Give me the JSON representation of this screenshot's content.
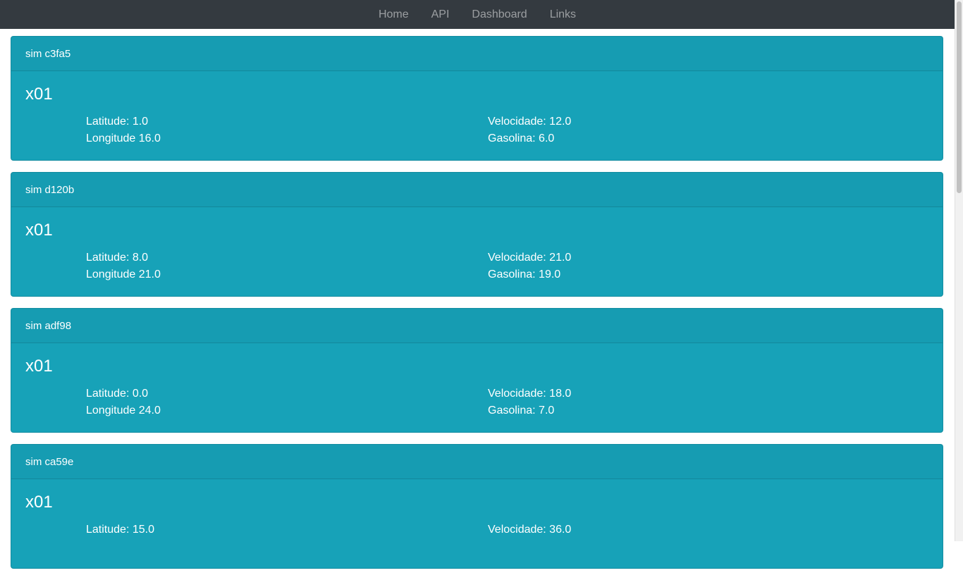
{
  "nav": {
    "items": [
      "Home",
      "API",
      "Dashboard",
      "Links"
    ]
  },
  "cards": [
    {
      "header": "sim c3fa5",
      "title": "x01",
      "latitude": "Latitude: 1.0",
      "longitude": "Longitude 16.0",
      "velocidade": "Velocidade: 12.0",
      "gasolina": "Gasolina: 6.0"
    },
    {
      "header": "sim d120b",
      "title": "x01",
      "latitude": "Latitude: 8.0",
      "longitude": "Longitude 21.0",
      "velocidade": "Velocidade: 21.0",
      "gasolina": "Gasolina: 19.0"
    },
    {
      "header": "sim adf98",
      "title": "x01",
      "latitude": "Latitude: 0.0",
      "longitude": "Longitude 24.0",
      "velocidade": "Velocidade: 18.0",
      "gasolina": "Gasolina: 7.0"
    },
    {
      "header": "sim ca59e",
      "title": "x01",
      "latitude": "Latitude: 15.0",
      "longitude": "",
      "velocidade": "Velocidade: 36.0",
      "gasolina": ""
    }
  ],
  "colors": {
    "navbar": "#343a40",
    "card": "#17a2b8",
    "text": "#ffffff"
  }
}
